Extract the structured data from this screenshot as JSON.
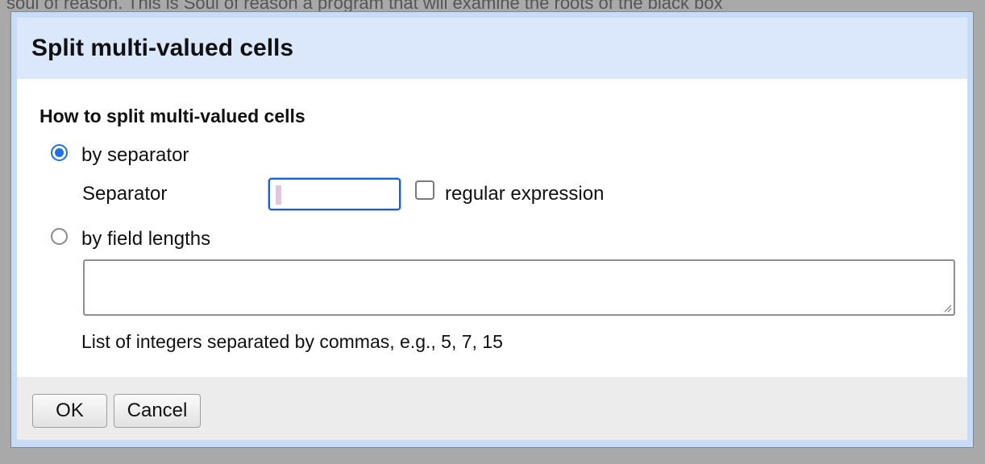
{
  "background": {
    "text": "soul of reason. This is Soul of reason a program that will examine the roots of the black box"
  },
  "dialog": {
    "title": "Split multi-valued cells",
    "section_heading": "How to split multi-valued cells",
    "options": {
      "by_separator": {
        "label": "by separator",
        "selected": true
      },
      "by_field_lengths": {
        "label": "by field lengths",
        "selected": false
      }
    },
    "separator": {
      "label": "Separator",
      "value": "",
      "regex_label": "regular expression",
      "regex_checked": false
    },
    "field_lengths": {
      "value": "",
      "hint": "List of integers separated by commas, e.g., 5, 7, 15"
    },
    "buttons": {
      "ok": "OK",
      "cancel": "Cancel"
    }
  },
  "colors": {
    "accent": "#1f6fe5",
    "header_bg": "#dbe8fc",
    "frame": "#c8dcf8",
    "footer_bg": "#ececec"
  }
}
